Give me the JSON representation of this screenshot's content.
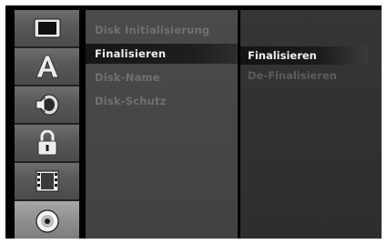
{
  "menu": {
    "items": [
      {
        "label": "Disk Initialisierung",
        "state": "disabled"
      },
      {
        "label": "Finalisieren",
        "state": "selected"
      },
      {
        "label": "Disk-Name",
        "state": "disabled"
      },
      {
        "label": "Disk-Schutz",
        "state": "disabled"
      }
    ]
  },
  "options": {
    "items": [
      {
        "label": "Finalisieren",
        "state": "selected"
      },
      {
        "label": "De-Finalisieren",
        "state": "disabled"
      }
    ]
  },
  "categories": [
    {
      "icon": "display-icon"
    },
    {
      "icon": "language-icon"
    },
    {
      "icon": "audio-icon"
    },
    {
      "icon": "lock-icon"
    },
    {
      "icon": "film-icon"
    },
    {
      "icon": "disc-icon",
      "state": "selected"
    }
  ],
  "colors": {
    "background": "#000000",
    "icon_cell": "#5a5a5a",
    "icon_cell_selected": "#8e8e8e",
    "menu_panel": "#454545",
    "options_panel": "#303030",
    "highlight_text": "#f0f0f0",
    "disabled_text": "#707070"
  }
}
